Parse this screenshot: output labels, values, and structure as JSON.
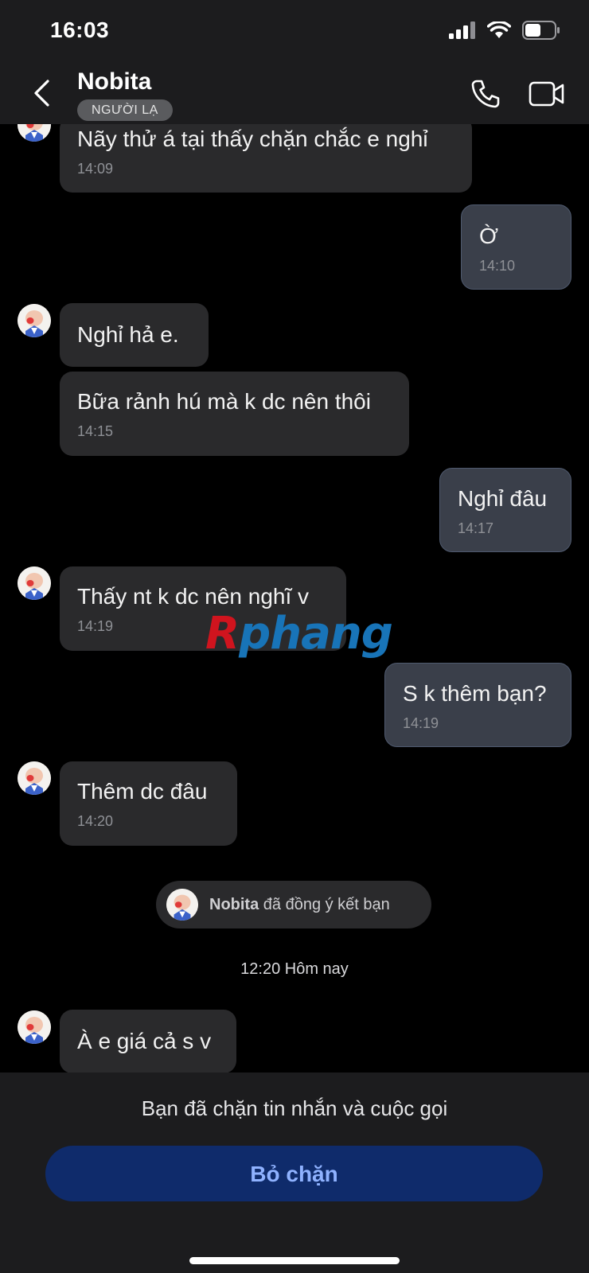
{
  "status_bar": {
    "time": "16:03"
  },
  "header": {
    "contact_name": "Nobita",
    "stranger_badge": "NGƯỜI LẠ",
    "back_icon": "chevron-left-icon",
    "call_icon": "phone-icon",
    "video_icon": "video-camera-icon"
  },
  "messages": [
    {
      "direction": "in",
      "text": "Nãy thử á tại thấy chặn chắc e nghỉ",
      "time": "14:09"
    },
    {
      "direction": "out",
      "text": "Ờ",
      "time": "14:10"
    },
    {
      "direction": "in",
      "text": "Nghỉ hả e.",
      "time": ""
    },
    {
      "direction": "in",
      "text": "Bữa rảnh hú mà k dc nên thôi",
      "time": "14:15"
    },
    {
      "direction": "out",
      "text": "Nghỉ đâu",
      "time": "14:17"
    },
    {
      "direction": "in",
      "text": "Thấy nt k dc nên nghĩ v",
      "time": "14:19"
    },
    {
      "direction": "out",
      "text": "S k thêm bạn?",
      "time": "14:19"
    },
    {
      "direction": "in",
      "text": "Thêm dc đâu",
      "time": "14:20"
    },
    {
      "direction": "in",
      "text": "À e giá cả s v",
      "time": ""
    }
  ],
  "system_message": {
    "name": "Nobita",
    "text": " đã đồng ý kết bạn"
  },
  "date_separator": "12:20 Hôm nay",
  "watermark": "Rphang",
  "footer": {
    "blocked_text": "Bạn đã chặn tin nhắn và cuộc gọi",
    "unblock_label": "Bỏ chặn"
  },
  "colors": {
    "background": "#000000",
    "header_bg": "#1c1c1e",
    "incoming_bubble": "#2a2a2c",
    "outgoing_bubble": "#3a3f4a",
    "unblock_button": "#0f2b6b",
    "unblock_text": "#8fb2ff"
  }
}
